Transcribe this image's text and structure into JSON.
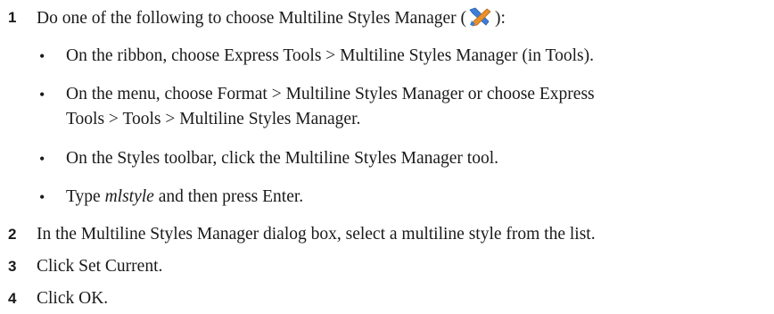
{
  "steps": [
    {
      "number": "1",
      "text_before_icon": "Do one of the following to choose Multiline Styles Manager (",
      "icon": "multiline-styles-manager-icon",
      "text_after_icon": "):",
      "bullets": [
        {
          "text": "On the ribbon, choose Express Tools > Multiline Styles Manager (in Tools)."
        },
        {
          "line1": "On the menu, choose Format > Multiline Styles Manager or choose Express",
          "line2": "Tools > Tools > Multiline Styles Manager."
        },
        {
          "text": "On the Styles toolbar, click the Multiline Styles Manager tool."
        },
        {
          "italic": "mlstyle",
          "prefix": "Type ",
          "suffix": " and then press Enter."
        }
      ]
    },
    {
      "number": "2",
      "text": "In the Multiline Styles Manager dialog box, select a multiline style from the list."
    },
    {
      "number": "3",
      "text": "Click Set Current."
    },
    {
      "number": "4",
      "text": "Click OK."
    }
  ],
  "bullet_glyph": "•",
  "colors": {
    "text": "#1a1a1a",
    "icon_blue": "#3d7fd6",
    "icon_orange": "#e8902a"
  }
}
